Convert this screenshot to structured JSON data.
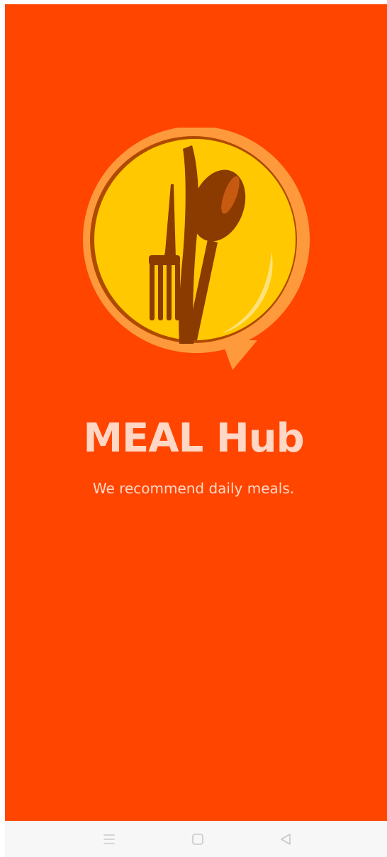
{
  "app": {
    "name": "MEAL Hub",
    "tagline": "We recommend daily meals."
  },
  "logo": {
    "icon": "fork-and-spoon-plate-icon"
  },
  "colors": {
    "background": "#ff4500",
    "title": "#ffd7c4",
    "logo_ring": "#ff9a3c",
    "logo_plate": "#ffc800",
    "logo_utensils": "#8b3a00",
    "navbar": "#f7f7f7"
  },
  "navigation_bar": {
    "buttons": [
      "menu-icon",
      "home-icon",
      "back-icon"
    ]
  }
}
